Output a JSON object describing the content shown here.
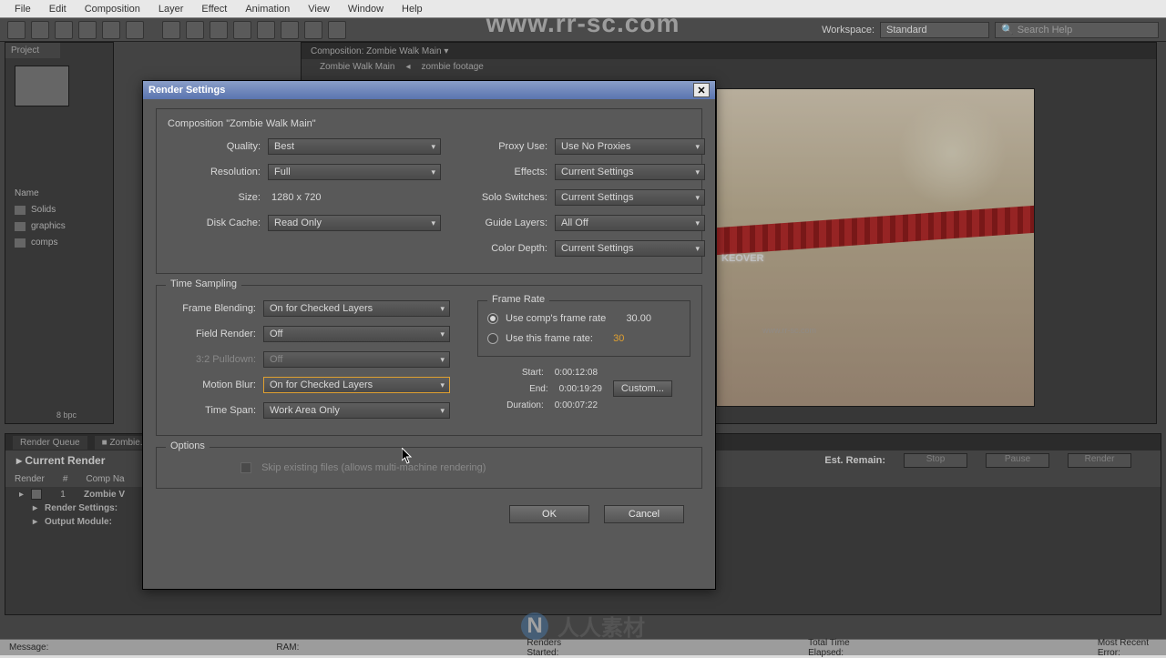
{
  "menu": {
    "file": "File",
    "edit": "Edit",
    "composition": "Composition",
    "layer": "Layer",
    "effect": "Effect",
    "animation": "Animation",
    "view": "View",
    "window": "Window",
    "help": "Help"
  },
  "toolbar": {
    "workspace_label": "Workspace:",
    "workspace_value": "Standard",
    "search_placeholder": "Search Help"
  },
  "project": {
    "tab": "Project",
    "name_header": "Name",
    "items": [
      {
        "label": "Solids"
      },
      {
        "label": "graphics"
      },
      {
        "label": "comps"
      }
    ],
    "footer_bpc": "8 bpc"
  },
  "comp_panel": {
    "tab_prefix": "Composition:",
    "tab_name": "Zombie Walk Main",
    "breadcrumb": [
      "Zombie Walk Main",
      "zombie footage"
    ],
    "preview_text": "KEOVER",
    "watermark": "www.rr-sc.com"
  },
  "render_queue": {
    "tab1": "Render Queue",
    "tab2": "Zombie...",
    "current_render": "Current Render",
    "est_remain": "Est. Remain:",
    "btn_stop": "Stop",
    "btn_pause": "Pause",
    "btn_render": "Render",
    "header": {
      "render": "Render",
      "num": "#",
      "comp": "Comp Na"
    },
    "row": {
      "num": "1",
      "name": "Zombie V"
    },
    "settings_label": "Render Settings:",
    "output_label": "Output Module:"
  },
  "status_bar": {
    "message": "Message:",
    "ram": "RAM:",
    "renders_started": "Renders Started:",
    "total_time": "Total Time Elapsed:",
    "recent_error": "Most Recent Error:"
  },
  "dialog": {
    "title": "Render Settings",
    "comp_line": "Composition \"Zombie Walk Main\"",
    "labels": {
      "quality": "Quality:",
      "resolution": "Resolution:",
      "size": "Size:",
      "disk_cache": "Disk Cache:",
      "proxy": "Proxy Use:",
      "effects": "Effects:",
      "solo": "Solo Switches:",
      "guide": "Guide Layers:",
      "depth": "Color Depth:",
      "time_sampling": "Time Sampling",
      "frame_blending": "Frame Blending:",
      "field_render": "Field Render:",
      "pulldown": "3:2 Pulldown:",
      "motion_blur": "Motion Blur:",
      "time_span": "Time Span:",
      "frame_rate": "Frame Rate",
      "use_comp": "Use comp's frame rate",
      "use_this": "Use this frame rate:",
      "start": "Start:",
      "end": "End:",
      "duration": "Duration:",
      "options": "Options",
      "skip": "Skip existing files (allows multi-machine rendering)",
      "ok": "OK",
      "cancel": "Cancel",
      "custom": "Custom..."
    },
    "values": {
      "quality": "Best",
      "resolution": "Full",
      "size": "1280 x 720",
      "disk_cache": "Read Only",
      "proxy": "Use No Proxies",
      "effects": "Current Settings",
      "solo": "Current Settings",
      "guide": "All Off",
      "depth": "Current Settings",
      "frame_blending": "On for Checked Layers",
      "field_render": "Off",
      "pulldown": "Off",
      "motion_blur": "On for Checked Layers",
      "time_span": "Work Area Only",
      "comp_rate": "30.00",
      "this_rate": "30",
      "start": "0:00:12:08",
      "end": "0:00:19:29",
      "duration": "0:00:07:22"
    }
  },
  "watermarks": {
    "main": "www.rr-sc.com",
    "bottom": "人人素材",
    "logo": "N"
  }
}
